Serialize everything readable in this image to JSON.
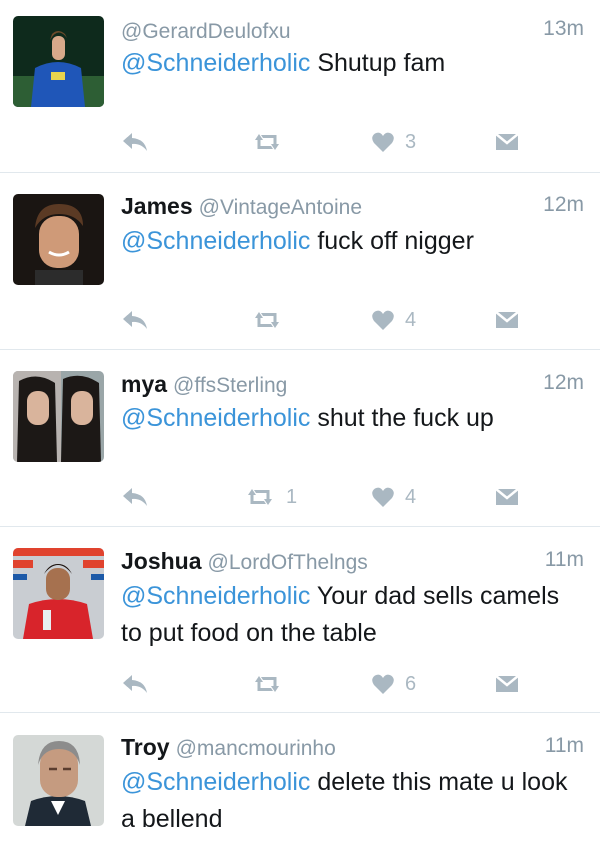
{
  "tweets": [
    {
      "name": "",
      "handle": "@GerardDeulofxu",
      "time": "13m",
      "mention": "@Schneiderholic",
      "text": " Shutup fam",
      "retweets": "",
      "likes": "3"
    },
    {
      "name": "James",
      "handle": "@VintageAntoine",
      "time": "12m",
      "mention": "@Schneiderholic",
      "text": " fuck off nigger",
      "retweets": "",
      "likes": "4"
    },
    {
      "name": "mya",
      "handle": "@ffsSterling",
      "time": "12m",
      "mention": "@Schneiderholic",
      "text": " shut the fuck up",
      "retweets": "1",
      "likes": "4"
    },
    {
      "name": "Joshua",
      "handle": "@LordOfThelngs",
      "time": "11m",
      "mention": "@Schneiderholic",
      "text": " Your dad sells camels to put food on the table",
      "retweets": "",
      "likes": "6"
    },
    {
      "name": "Troy",
      "handle": "@mancmourinho",
      "time": "11m",
      "mention": "@Schneiderholic",
      "text": " delete this mate u look a bellend",
      "retweets": "",
      "likes": ""
    }
  ],
  "icons": {
    "reply": "reply-icon",
    "retweet": "retweet-icon",
    "like": "heart-icon",
    "dm": "direct-message-icon"
  },
  "colors": {
    "mention": "#3b94d9",
    "muted": "#8899a6",
    "action": "#aab8c2",
    "divider": "#e1e8ed"
  }
}
